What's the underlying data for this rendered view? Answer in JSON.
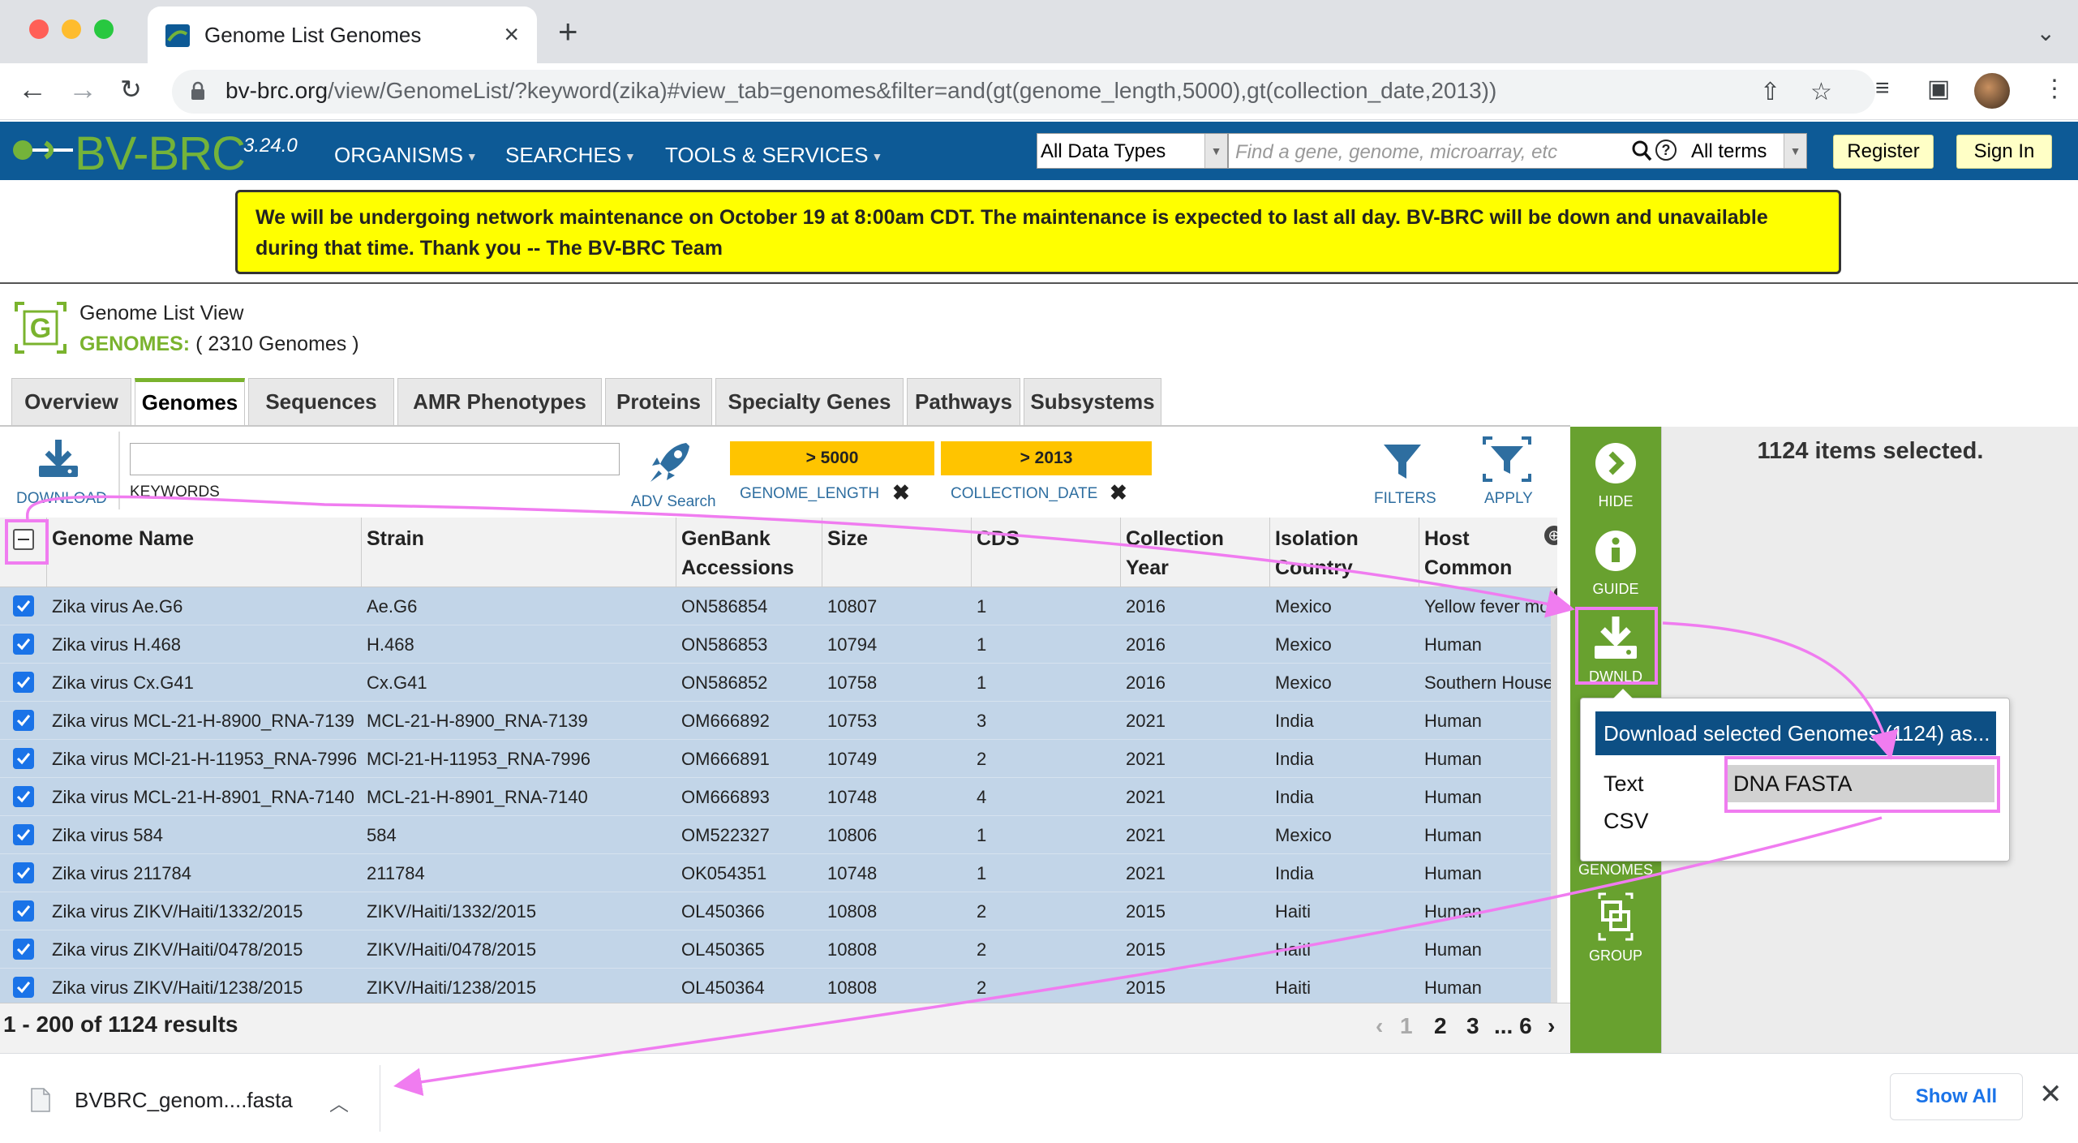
{
  "browser": {
    "tab_title": "Genome List Genomes",
    "url_host": "bv-brc.org",
    "url_path": "/view/GenomeList/?keyword(zika)#view_tab=genomes&filter=and(gt(genome_length,5000),gt(collection_date,2013))"
  },
  "header": {
    "logo": "BV-BRC",
    "version": "3.24.0",
    "nav": [
      "ORGANISMS",
      "SEARCHES",
      "TOOLS & SERVICES"
    ],
    "data_type_select": "All Data Types",
    "search_placeholder": "Find a gene, genome, microarray, etc",
    "terms_select": "All terms",
    "register": "Register",
    "sign_in": "Sign In"
  },
  "banner": "We will be undergoing network maintenance on October 19 at 8:00am CDT. The maintenance is expected to last all day. BV-BRC will be down and unavailable during that time. Thank you -- The BV-BRC Team",
  "page": {
    "subtitle": "Genome List View",
    "title_label": "GENOMES:",
    "title_count": "( 2310 Genomes )"
  },
  "tabs": [
    "Overview",
    "Genomes",
    "Sequences",
    "AMR Phenotypes",
    "Proteins",
    "Specialty Genes",
    "Pathways",
    "Subsystems"
  ],
  "active_tab": "Genomes",
  "toolbar": {
    "download": "DOWNLOAD",
    "keywords": "KEYWORDS",
    "keyword_value": "",
    "adv_search": "ADV Search",
    "filters": "FILTERS",
    "apply": "APPLY",
    "filter_chips": [
      {
        "value": "> 5000",
        "field": "GENOME_LENGTH"
      },
      {
        "value": "> 2013",
        "field": "COLLECTION_DATE"
      }
    ]
  },
  "grid": {
    "columns": [
      {
        "label": "Genome Name"
      },
      {
        "label": "Strain"
      },
      {
        "label": "GenBank Accessions"
      },
      {
        "label": "Size"
      },
      {
        "label": "CDS"
      },
      {
        "label": "Collection Year"
      },
      {
        "label": "Isolation Country"
      },
      {
        "label": "Host Common Name"
      }
    ],
    "rows": [
      [
        "Zika virus Ae.G6",
        "Ae.G6",
        "ON586854",
        "10807",
        "1",
        "2016",
        "Mexico",
        "Yellow fever mosquito"
      ],
      [
        "Zika virus H.468",
        "H.468",
        "ON586853",
        "10794",
        "1",
        "2016",
        "Mexico",
        "Human"
      ],
      [
        "Zika virus Cx.G41",
        "Cx.G41",
        "ON586852",
        "10758",
        "1",
        "2016",
        "Mexico",
        "Southern House"
      ],
      [
        "Zika virus MCL-21-H-8900_RNA-7139",
        "MCL-21-H-8900_RNA-7139",
        "OM666892",
        "10753",
        "3",
        "2021",
        "India",
        "Human"
      ],
      [
        "Zika virus MCl-21-H-11953_RNA-7996",
        "MCl-21-H-11953_RNA-7996",
        "OM666891",
        "10749",
        "2",
        "2021",
        "India",
        "Human"
      ],
      [
        "Zika virus MCL-21-H-8901_RNA-7140",
        "MCL-21-H-8901_RNA-7140",
        "OM666893",
        "10748",
        "4",
        "2021",
        "India",
        "Human"
      ],
      [
        "Zika virus 584",
        "584",
        "OM522327",
        "10806",
        "1",
        "2021",
        "Mexico",
        "Human"
      ],
      [
        "Zika virus 211784",
        "211784",
        "OK054351",
        "10748",
        "1",
        "2021",
        "India",
        "Human"
      ],
      [
        "Zika virus ZIKV/Haiti/1332/2015",
        "ZIKV/Haiti/1332/2015",
        "OL450366",
        "10808",
        "2",
        "2015",
        "Haiti",
        "Human"
      ],
      [
        "Zika virus ZIKV/Haiti/0478/2015",
        "ZIKV/Haiti/0478/2015",
        "OL450365",
        "10808",
        "2",
        "2015",
        "Haiti",
        "Human"
      ],
      [
        "Zika virus ZIKV/Haiti/1238/2015",
        "ZIKV/Haiti/1238/2015",
        "OL450364",
        "10808",
        "2",
        "2015",
        "Haiti",
        "Human"
      ]
    ],
    "results": "1 - 200 of 1124 results",
    "pager": [
      "‹",
      "1",
      "2",
      "3",
      "... 6",
      "›"
    ]
  },
  "actionbar": {
    "hide": "HIDE",
    "guide": "GUIDE",
    "dwnld": "DWNLD",
    "genomes": "GENOMES",
    "group": "GROUP"
  },
  "selection": "1124 items selected.",
  "download_popup": {
    "title": "Download selected Genomes (1124) as...",
    "text_label": "Text",
    "csv_label": "CSV",
    "option": "DNA FASTA"
  },
  "download_shelf": {
    "file": "BVBRC_genom....fasta",
    "show_all": "Show All"
  },
  "colors": {
    "header_blue": "#0d5a96",
    "brand_green": "#74b33a",
    "action_green": "#68a12f",
    "filter_chip": "#ffc400",
    "selected_row": "#c2d5e8",
    "annotation": "#f07cf0"
  }
}
